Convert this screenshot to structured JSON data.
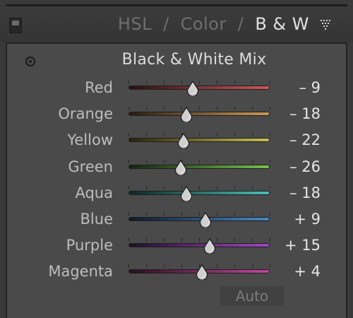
{
  "header": {
    "tabs": [
      {
        "label": "HSL",
        "active": false
      },
      {
        "label": "Color",
        "active": false
      },
      {
        "label": "B & W",
        "active": true
      }
    ],
    "separator": "/",
    "menu_icon": "triangle-menu-icon"
  },
  "panel": {
    "title": "Black & White Mix",
    "target_icon": "target-adjustment-icon",
    "auto_label": "Auto",
    "range": [
      -100,
      100
    ],
    "sliders": [
      {
        "label": "Red",
        "value": -9,
        "display": "– 9",
        "color_dark": "#2b1010",
        "color_light": "#d05858"
      },
      {
        "label": "Orange",
        "value": -18,
        "display": "– 18",
        "color_dark": "#2a1d10",
        "color_light": "#c89858"
      },
      {
        "label": "Yellow",
        "value": -22,
        "display": "– 22",
        "color_dark": "#27240e",
        "color_light": "#c8c050"
      },
      {
        "label": "Green",
        "value": -26,
        "display": "– 26",
        "color_dark": "#122612",
        "color_light": "#78c048"
      },
      {
        "label": "Aqua",
        "value": -18,
        "display": "– 18",
        "color_dark": "#102624",
        "color_light": "#48c0b8"
      },
      {
        "label": "Blue",
        "value": 9,
        "display": "+ 9",
        "color_dark": "#101a28",
        "color_light": "#4888c8"
      },
      {
        "label": "Purple",
        "value": 15,
        "display": "+ 15",
        "color_dark": "#20102a",
        "color_light": "#a048c0"
      },
      {
        "label": "Magenta",
        "value": 4,
        "display": "+ 4",
        "color_dark": "#28101e",
        "color_light": "#c0489a"
      }
    ]
  }
}
